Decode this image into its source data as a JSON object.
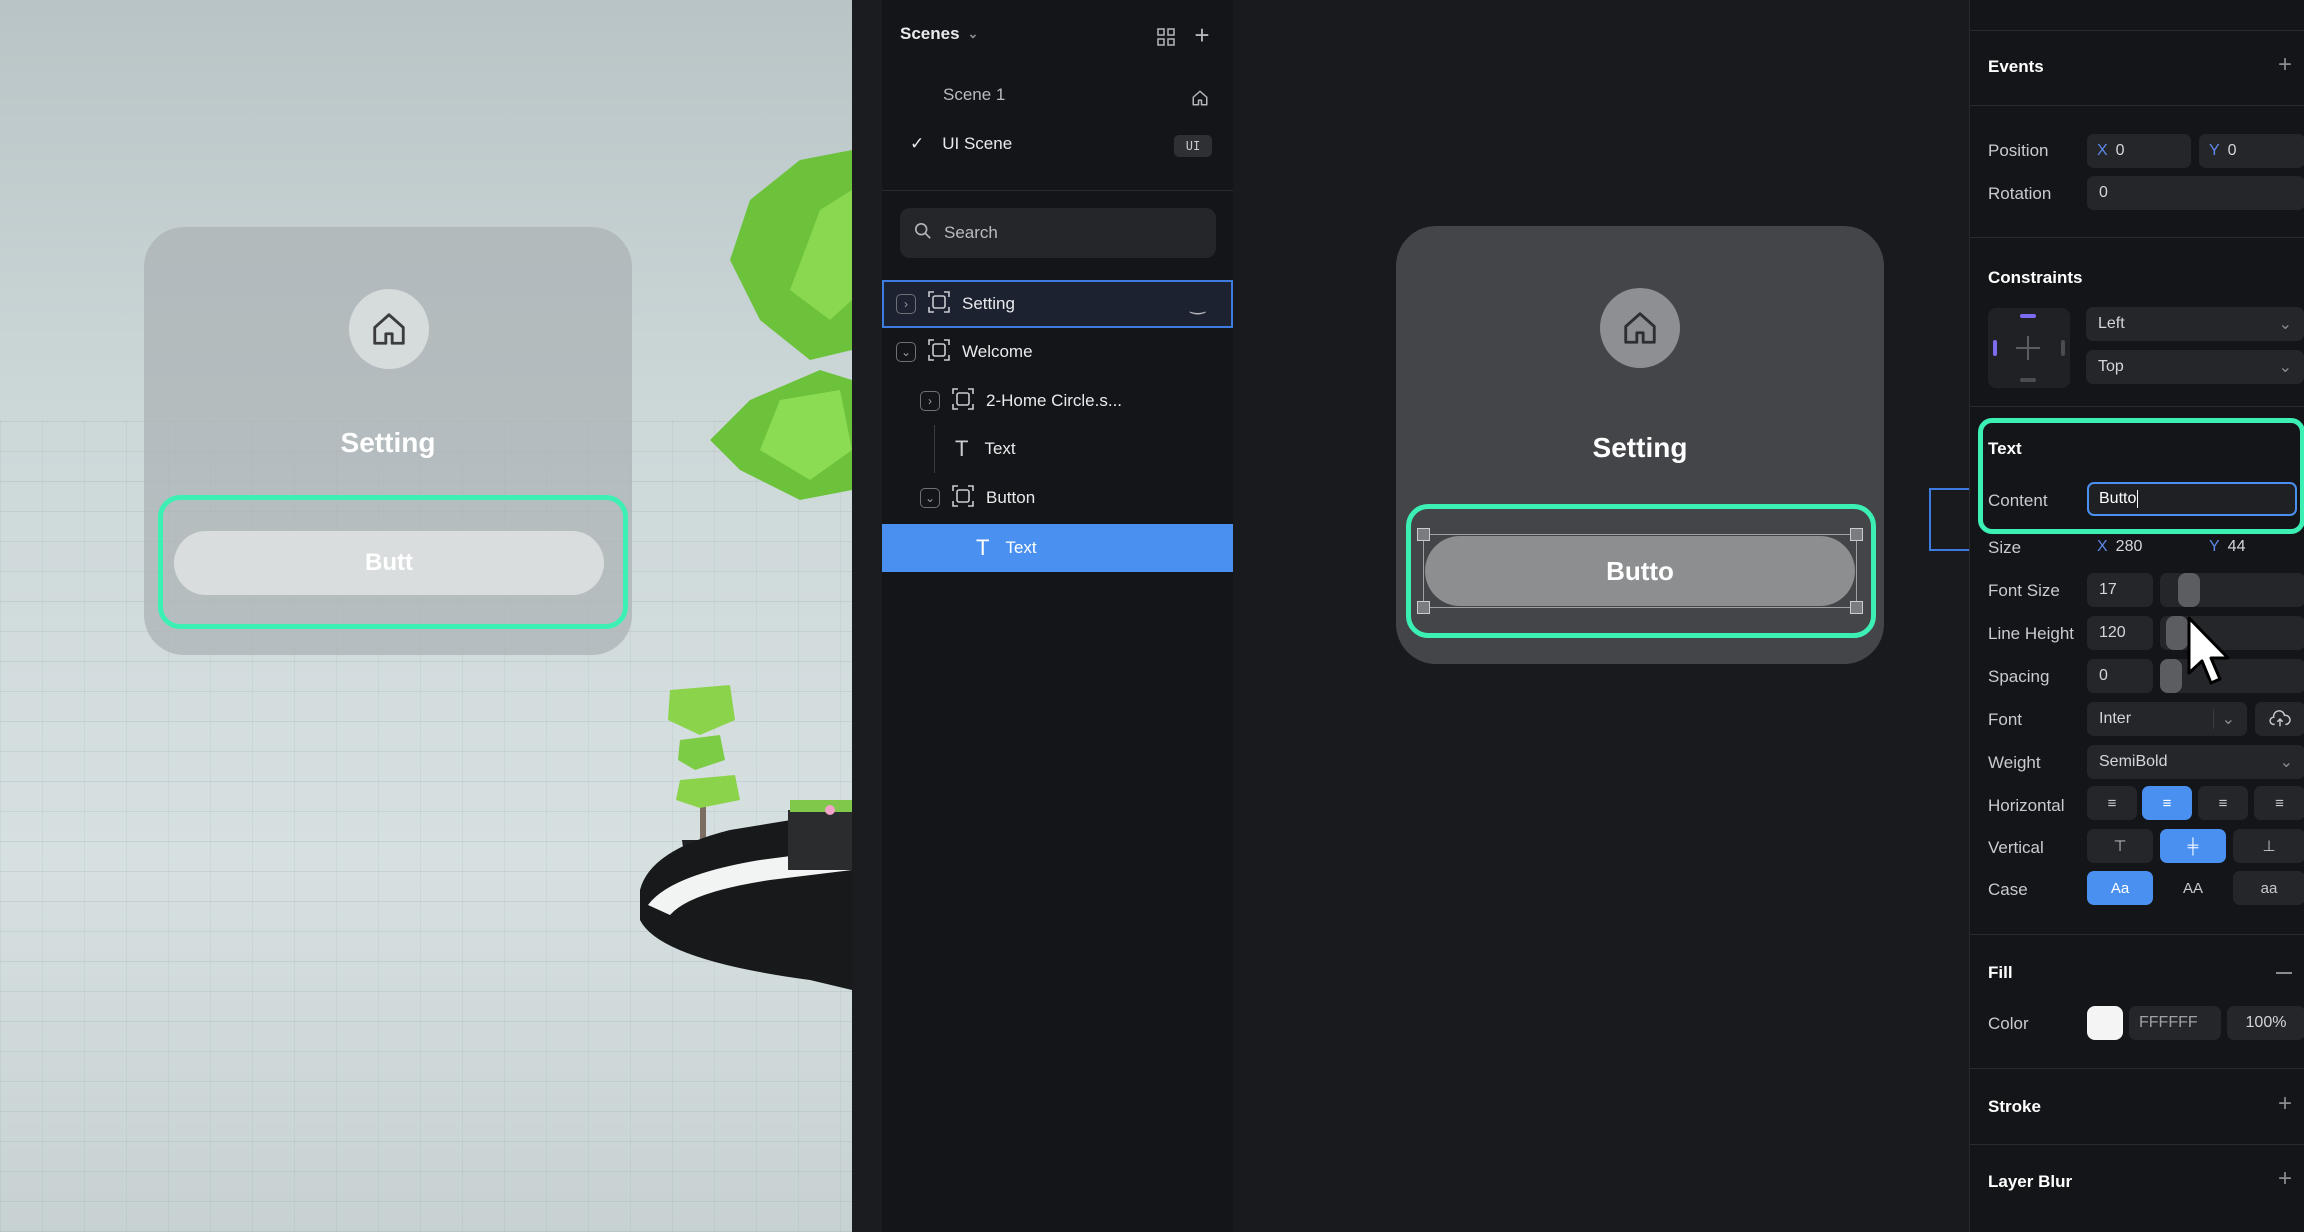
{
  "preview": {
    "card_title": "Setting",
    "button_text": "Butt"
  },
  "scenes_panel": {
    "header": "Scenes",
    "scenes": [
      {
        "name": "Scene 1",
        "checked": false
      },
      {
        "name": "UI Scene",
        "checked": true,
        "badge": "UI"
      }
    ],
    "search_placeholder": "Search",
    "layers": [
      {
        "name": "Setting",
        "type": "frame"
      },
      {
        "name": "Welcome",
        "type": "frame"
      },
      {
        "name": "2-Home Circle.s...",
        "type": "frame"
      },
      {
        "name": "Text",
        "type": "text"
      },
      {
        "name": "Button",
        "type": "frame"
      },
      {
        "name": "Text",
        "type": "text"
      }
    ]
  },
  "canvas": {
    "card_title": "Setting",
    "button_text": "Butto"
  },
  "properties": {
    "events_label": "Events",
    "position_label": "Position",
    "position_x_axis": "X",
    "position_x": "0",
    "position_y_axis": "Y",
    "position_y": "0",
    "rotation_label": "Rotation",
    "rotation": "0",
    "constraints_label": "Constraints",
    "constraint_h": "Left",
    "constraint_v": "Top",
    "text_label": "Text",
    "content_label": "Content",
    "content_value": "Butto",
    "size_label": "Size",
    "size_x_axis": "X",
    "size_x": "280",
    "size_y_axis": "Y",
    "size_y": "44",
    "font_size_label": "Font Size",
    "font_size": "17",
    "line_height_label": "Line Height",
    "line_height": "120",
    "spacing_label": "Spacing",
    "spacing": "0",
    "font_label": "Font",
    "font_value": "Inter",
    "weight_label": "Weight",
    "weight_value": "SemiBold",
    "horizontal_label": "Horizontal",
    "vertical_label": "Vertical",
    "case_label": "Case",
    "case_options": [
      "Aa",
      "AA",
      "aa"
    ],
    "fill_label": "Fill",
    "color_label": "Color",
    "color_hex": "FFFFFF",
    "color_opacity": "100%",
    "stroke_label": "Stroke",
    "layer_blur_label": "Layer Blur"
  },
  "colors": {
    "accent_blue": "#4a90f0",
    "highlight_green": "#3cf0b4"
  }
}
